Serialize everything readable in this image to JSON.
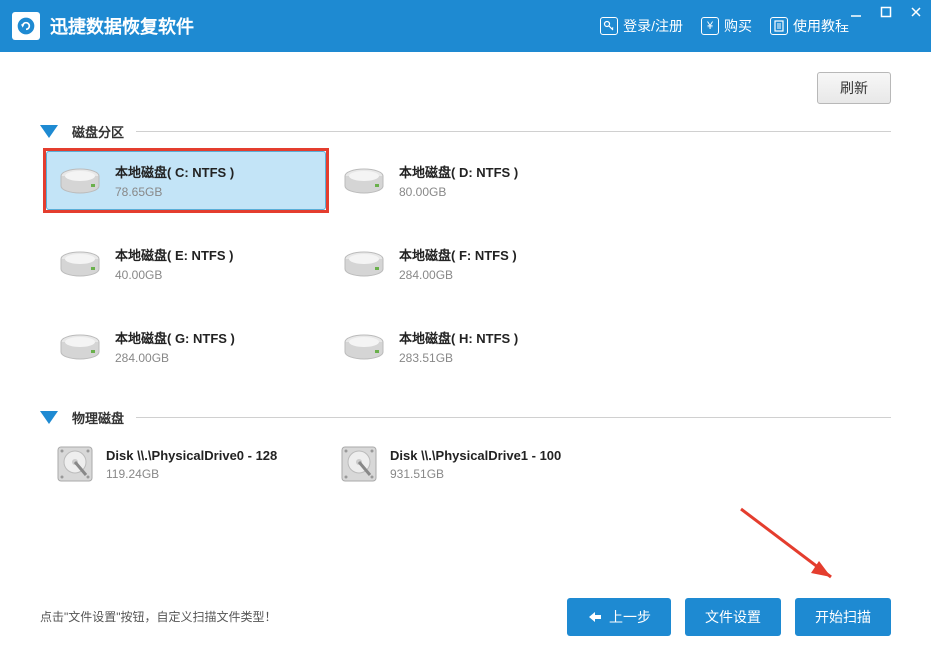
{
  "app": {
    "title": "迅捷数据恢复软件"
  },
  "header": {
    "login": "登录/注册",
    "buy": "购买",
    "tutorial": "使用教程"
  },
  "refresh_label": "刷新",
  "sections": {
    "partitions": "磁盘分区",
    "physical": "物理磁盘"
  },
  "partitions": [
    {
      "name": "本地磁盘( C: NTFS )",
      "size": "78.65GB",
      "selected": true
    },
    {
      "name": "本地磁盘( D: NTFS )",
      "size": "80.00GB",
      "selected": false
    },
    {
      "name": "本地磁盘( E: NTFS )",
      "size": "40.00GB",
      "selected": false
    },
    {
      "name": "本地磁盘( F: NTFS )",
      "size": "284.00GB",
      "selected": false
    },
    {
      "name": "本地磁盘( G: NTFS )",
      "size": "284.00GB",
      "selected": false
    },
    {
      "name": "本地磁盘( H: NTFS )",
      "size": "283.51GB",
      "selected": false
    }
  ],
  "physical": [
    {
      "name": "Disk \\\\.\\PhysicalDrive0 - 128",
      "size": "119.24GB"
    },
    {
      "name": "Disk \\\\.\\PhysicalDrive1 - 100",
      "size": "931.51GB"
    }
  ],
  "footer": {
    "hint": "点击\"文件设置\"按钮，自定义扫描文件类型！",
    "back": "上一步",
    "settings": "文件设置",
    "scan": "开始扫描"
  }
}
